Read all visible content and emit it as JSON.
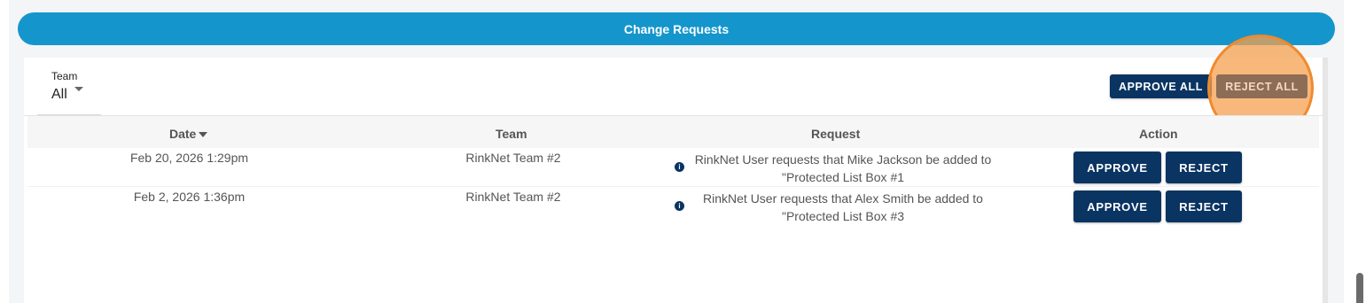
{
  "header": {
    "title": "Change Requests"
  },
  "filter": {
    "label": "Team",
    "value": "All"
  },
  "toolbar": {
    "approve_all": "APPROVE ALL",
    "reject_all": "REJECT ALL"
  },
  "table": {
    "columns": {
      "date": "Date",
      "team": "Team",
      "request": "Request",
      "action": "Action"
    },
    "rows": [
      {
        "date": "Feb 20, 2026 1:29pm",
        "team": "RinkNet Team #2",
        "request_line1": "RinkNet User requests that Mike Jackson be added to",
        "request_line2": "\"Protected List Box #1",
        "approve": "APPROVE",
        "reject": "REJECT"
      },
      {
        "date": "Feb 2, 2026 1:36pm",
        "team": "RinkNet Team #2",
        "request_line1": "RinkNet User requests that Alex Smith be added to",
        "request_line2": "\"Protected List Box #3",
        "approve": "APPROVE",
        "reject": "REJECT"
      }
    ]
  },
  "colors": {
    "header_blue": "#1496cc",
    "navy": "#0a3462",
    "highlight_orange": "#f08a2c"
  }
}
